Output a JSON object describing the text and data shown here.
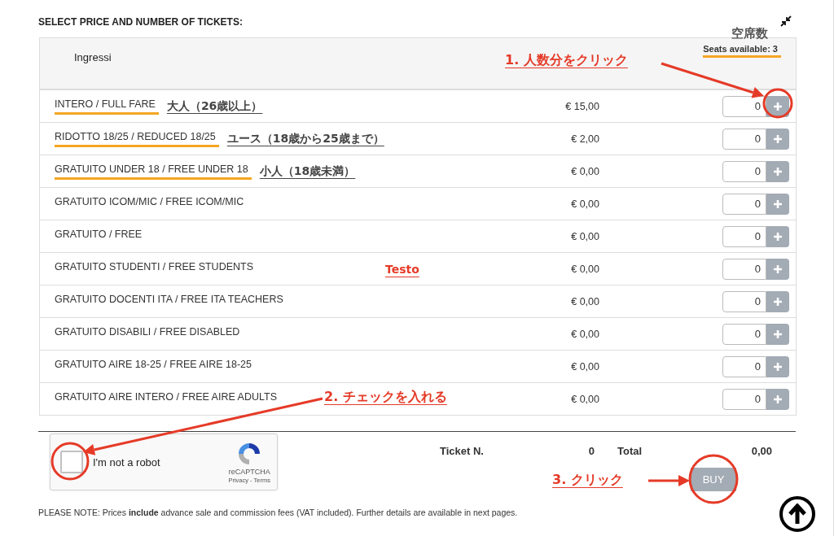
{
  "heading": "SELECT PRICE AND NUMBER OF TICKETS:",
  "seats_label": "空席数",
  "seats_available": "Seats available: 3",
  "group": "Ingressi",
  "tickets": [
    {
      "name": "INTERO / FULL FARE",
      "highlighted": true,
      "note": {
        "kind": "label",
        "text": "大人（26歳以上）"
      },
      "price": "€ 15,00",
      "quantity": "0"
    },
    {
      "name": "RIDOTTO 18/25 / REDUCED 18/25",
      "highlighted": true,
      "note": {
        "kind": "label",
        "text": "ユース（18歳から25歳まで）"
      },
      "price": "€ 2,00",
      "quantity": "0"
    },
    {
      "name": "GRATUITO UNDER 18 / FREE UNDER 18",
      "highlighted": true,
      "note": {
        "kind": "label",
        "text": "小人（18歳未満）"
      },
      "price": "€ 0,00",
      "quantity": "0"
    },
    {
      "name": "GRATUITO ICOM/MIC / FREE ICOM/MIC",
      "highlighted": false,
      "price": "€ 0,00",
      "quantity": "0"
    },
    {
      "name": "GRATUITO / FREE",
      "highlighted": false,
      "price": "€ 0,00",
      "quantity": "0"
    },
    {
      "name": "GRATUITO STUDENTI / FREE STUDENTS",
      "highlighted": false,
      "note": {
        "kind": "marker",
        "text": "Testo"
      },
      "price": "€ 0,00",
      "quantity": "0"
    },
    {
      "name": "GRATUITO DOCENTI ITA / FREE ITA TEACHERS",
      "highlighted": false,
      "price": "€ 0,00",
      "quantity": "0"
    },
    {
      "name": "GRATUITO DISABILI / FREE DISABLED",
      "highlighted": false,
      "price": "€ 0,00",
      "quantity": "0"
    },
    {
      "name": "GRATUITO AIRE 18-25 / FREE AIRE 18-25",
      "highlighted": false,
      "price": "€ 0,00",
      "quantity": "0"
    },
    {
      "name": "GRATUITO AIRE INTERO / FREE AIRE ADULTS",
      "highlighted": false,
      "price": "€ 0,00",
      "quantity": "0"
    }
  ],
  "captcha": {
    "label": "I'm not a robot",
    "checked": false,
    "brand": "reCAPTCHA",
    "links": "Privacy - Terms"
  },
  "summary": {
    "ticket_label": "Ticket N.",
    "ticket_count": "0",
    "total_label": "Total",
    "total": "0,00"
  },
  "buy": "BUY",
  "notice": "PLEASE NOTE: Prices **include** advance sale and commission fees (VAT included). Further details are available in next pages.",
  "callouts": [
    {
      "text": "1. 人数分をクリック"
    },
    {
      "text": "2. チェックを入れる"
    },
    {
      "text": "3. クリック"
    }
  ]
}
